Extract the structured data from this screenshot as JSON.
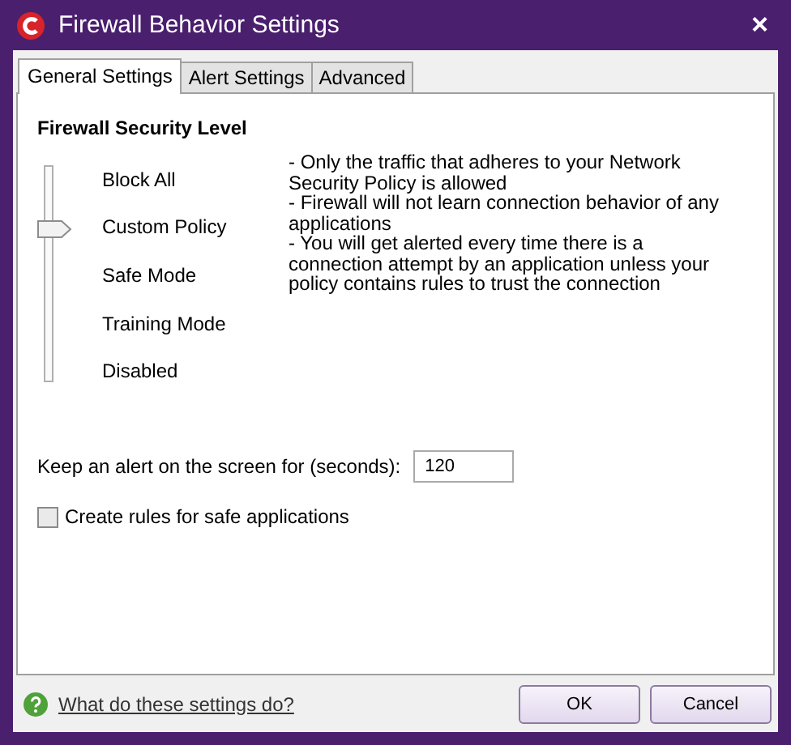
{
  "window": {
    "title": "Firewall Behavior Settings",
    "close": "×"
  },
  "tabs": [
    {
      "label": "General Settings",
      "selected": true
    },
    {
      "label": "Alert Settings",
      "selected": false
    },
    {
      "label": "Advanced",
      "selected": false
    }
  ],
  "section_title": "Firewall Security Level",
  "levels": [
    {
      "label": "Block All",
      "selected": false
    },
    {
      "label": "Custom Policy",
      "selected": true
    },
    {
      "label": "Safe Mode",
      "selected": false
    },
    {
      "label": "Training Mode",
      "selected": false
    },
    {
      "label": "Disabled",
      "selected": false
    }
  ],
  "description": [
    "- Only the traffic that adheres to your Network Security Policy is allowed",
    "- Firewall will not learn connection behavior of any applications",
    "- You will get alerted every time there is a connection attempt by an application unless your policy contains rules to trust the connection"
  ],
  "alert_duration": {
    "label": "Keep an alert on the screen for (seconds):",
    "value": "120"
  },
  "safe_rules": {
    "label": "Create rules for safe applications",
    "checked": false
  },
  "help_link": "What do these settings do?",
  "buttons": [
    "OK",
    "Cancel"
  ]
}
